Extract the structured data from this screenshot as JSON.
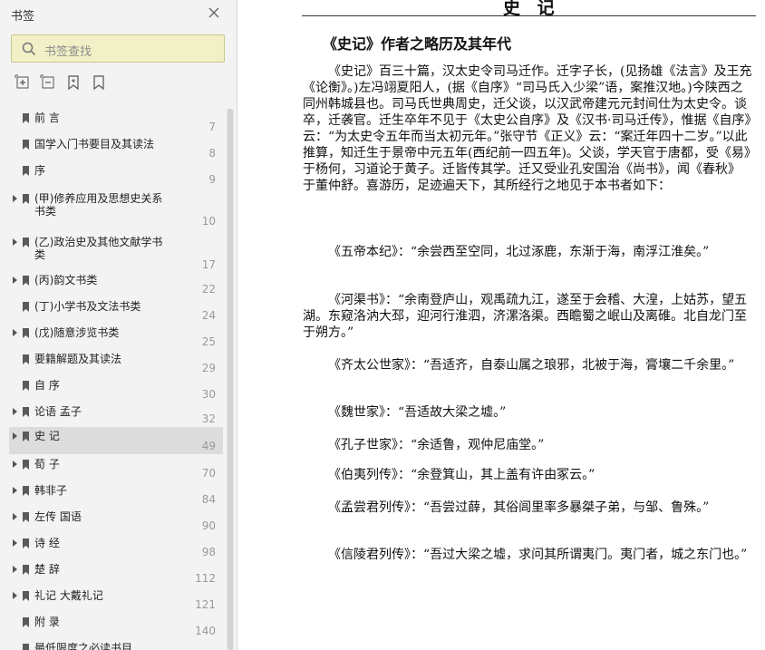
{
  "sidebar": {
    "title": "书签",
    "search_placeholder": "书签查找",
    "tools": [
      "expand-all-icon",
      "collapse-all-icon",
      "add-bookmark-icon",
      "bookmark-icon"
    ],
    "items": [
      {
        "label": "前 言",
        "page": "7",
        "expandable": false,
        "active": false
      },
      {
        "label": "国学入门书要目及其读法",
        "page": "8",
        "expandable": false,
        "active": false
      },
      {
        "label": "序",
        "page": "9",
        "expandable": false,
        "active": false
      },
      {
        "label": "(甲)修养应用及思想史关系",
        "label2": "书类",
        "page": "10",
        "expandable": true,
        "active": false
      },
      {
        "label": "(乙)政治史及其他文献学书",
        "label2": "类",
        "page": "17",
        "expandable": true,
        "active": false
      },
      {
        "label": "(丙)韵文书类",
        "page": "22",
        "expandable": true,
        "active": false
      },
      {
        "label": "(丁)小学书及文法书类",
        "page": "24",
        "expandable": false,
        "active": false
      },
      {
        "label": "(戊)随意涉览书类",
        "page": "25",
        "expandable": true,
        "active": false
      },
      {
        "label": "要籍解题及其读法",
        "page": "29",
        "expandable": false,
        "active": false
      },
      {
        "label": "自 序",
        "page": "30",
        "expandable": false,
        "active": false
      },
      {
        "label": "论语 孟子",
        "page": "32",
        "expandable": true,
        "active": false
      },
      {
        "label": "史 记",
        "page": "49",
        "expandable": true,
        "active": true
      },
      {
        "label": "荀 子",
        "page": "70",
        "expandable": true,
        "active": false
      },
      {
        "label": "韩非子",
        "page": "84",
        "expandable": true,
        "active": false
      },
      {
        "label": "左传 国语",
        "page": "90",
        "expandable": true,
        "active": false
      },
      {
        "label": "诗 经",
        "page": "98",
        "expandable": true,
        "active": false
      },
      {
        "label": "楚 辞",
        "page": "112",
        "expandable": true,
        "active": false
      },
      {
        "label": "礼记 大戴礼记",
        "page": "121",
        "expandable": true,
        "active": false
      },
      {
        "label": "附 录",
        "page": "140",
        "expandable": false,
        "active": false
      },
      {
        "label": "最低限度之必读书目",
        "page": "",
        "expandable": false,
        "active": false
      }
    ]
  },
  "page": {
    "running_head": "史 记",
    "heading": "《史记》作者之略历及其年代",
    "paragraphs": [
      "《史记》百三十篇，汉太史令司马迁作。迁字子长，(见扬雄《法言》及王充《论衡》。)左冯翊夏阳人，(据《自序》“司马氏入少梁”语，案推汉地。)今陕西之同州韩城县也。司马氏世典周史，迁父谈，以汉武帝建元元封间仕为太史令。谈卒，迁袭官。迁生卒年不见于《太史公自序》及《汉书·司马迁传》，惟据《自序》云：“为太史令五年而当太初元年。”张守节《正义》云：“案迁年四十二岁。”以此推算，知迁生于景帝中元五年(西纪前一四五年)。父谈，学天官于唐都，受《易》于杨何，习道论于黄子。迁皆传其学。迁又受业孔安国治《尚书》，闻《春秋》于董仲舒。喜游历，足迹遍天下，其所经行之地见于本书者如下：",
      "《五帝本纪》：“余尝西至空同，北过涿鹿，东渐于海，南浮江淮矣。”",
      "《河渠书》：“余南登庐山，观禹疏九江，遂至于会稽、大湟，上姑苏，望五湖。东窥洛汭大邳，迎河行淮泗，济漯洛渠。西瞻蜀之岷山及离碓。北自龙门至于朔方。”",
      "《齐太公世家》：“吾适齐，自泰山属之琅邪，北被于海，膏壤二千余里。”",
      "《魏世家》：“吾适故大梁之墟。”",
      "《孔子世家》：“余适鲁，观仲尼庙堂。”",
      "《伯夷列传》：“余登箕山，其上盖有许由冢云。”",
      "《孟尝君列传》：“吾尝过薛，其俗闾里率多暴桀子弟，与邹、鲁殊。”",
      "《信陵君列传》：“吾过大梁之墟，求问其所谓夷门。夷门者，城之东门也。”"
    ]
  }
}
